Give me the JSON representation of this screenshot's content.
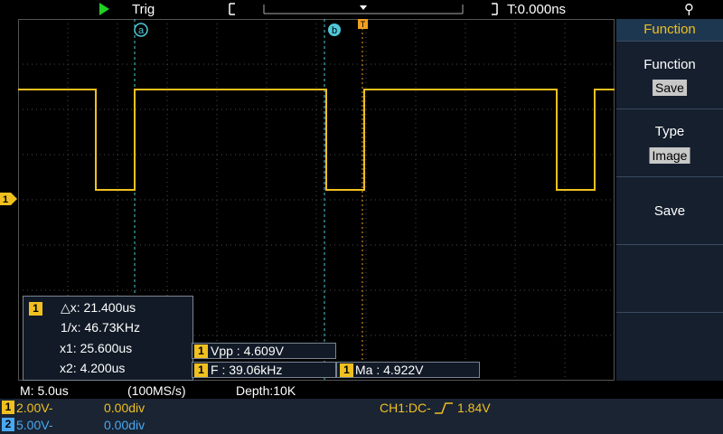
{
  "topbar": {
    "trig_label": "Trig",
    "time_offset": "T:0.000ns",
    "run_icon": "play-icon",
    "usb_icon": "usb-icon"
  },
  "cursors": {
    "a_label": "a",
    "b_label": "b",
    "trigger_marker": "T",
    "ch1_marker": "1"
  },
  "menu": {
    "header": "Function",
    "items": [
      {
        "title": "Function",
        "value": "Save"
      },
      {
        "title": "Type",
        "value": "Image"
      },
      {
        "title": "Save",
        "value": ""
      }
    ]
  },
  "cursor_box": {
    "channel": "1",
    "dx": "△x: 21.400us",
    "inv_dx": "1/x: 46.73KHz",
    "x1": "x1: 25.600us",
    "x2": "x2: 4.200us"
  },
  "measurements": [
    {
      "channel": "1",
      "text": "Vpp : 4.609V"
    },
    {
      "channel": "1",
      "text": "F : 39.06kHz"
    },
    {
      "channel": "1",
      "text": "Ma : 4.922V"
    }
  ],
  "status": {
    "timebase": "M: 5.0us",
    "sample_rate": "(100MS/s)",
    "depth": "Depth:10K",
    "ch1": {
      "num": "1",
      "volts": "2.00V-",
      "offset": "0.00div",
      "color": "#f0c020"
    },
    "ch2": {
      "num": "2",
      "volts": "5.00V-",
      "offset": "0.00div",
      "color": "#4aa8f0"
    },
    "trigger": "CH1:DC-",
    "trigger_level": "1.84V"
  },
  "colors": {
    "ch1": "#f0c020",
    "ch2": "#4aa8f0",
    "cursor": "#4fc8d8",
    "grid": "#4a4a4a",
    "menu_header": "#1e3750"
  }
}
